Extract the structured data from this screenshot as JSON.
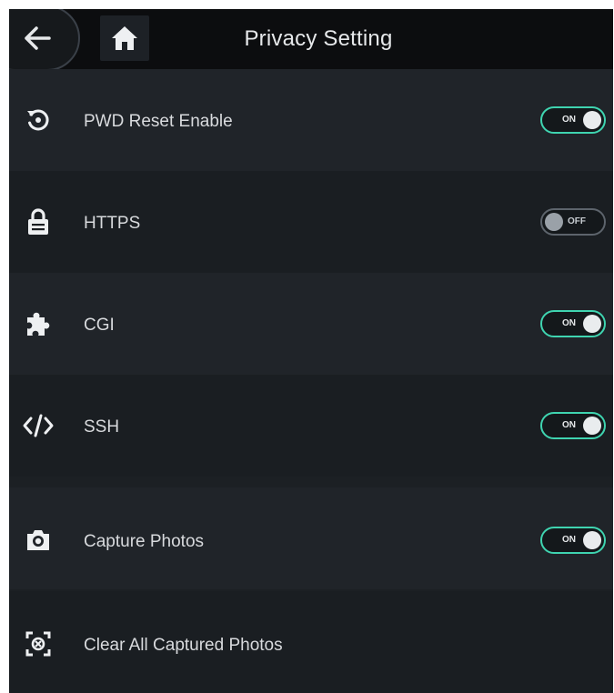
{
  "header": {
    "title": "Privacy Setting",
    "back_icon": "arrow-left-icon",
    "home_icon": "home-icon"
  },
  "colors": {
    "accent": "#3fd4b0",
    "background": "#1c2024",
    "header": "#0c0d0f",
    "text": "#d8dadd"
  },
  "settings": [
    {
      "label": "PWD Reset Enable",
      "icon": "reset-icon",
      "toggle": "ON",
      "state": true
    },
    {
      "label": "HTTPS",
      "icon": "lock-icon",
      "toggle": "OFF",
      "state": false
    },
    {
      "label": "CGI",
      "icon": "puzzle-icon",
      "toggle": "ON",
      "state": true
    },
    {
      "label": "SSH",
      "icon": "code-icon",
      "toggle": "ON",
      "state": true
    },
    {
      "label": "Capture Photos",
      "icon": "camera-icon",
      "toggle": "ON",
      "state": true
    },
    {
      "label": "Clear All Captured Photos",
      "icon": "clear-photos-icon"
    }
  ]
}
